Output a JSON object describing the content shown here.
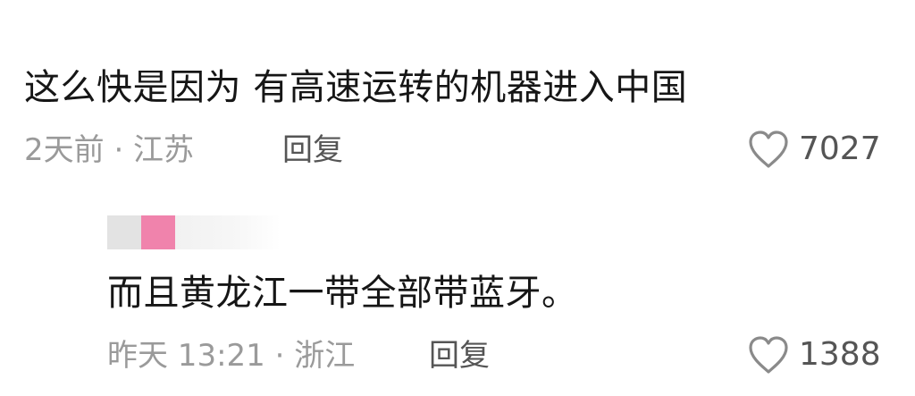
{
  "comments": [
    {
      "text": "这么快是因为 有高速运转的机器进入中国",
      "meta": "2天前 · 江苏",
      "reply_label": "回复",
      "likes": "7027"
    },
    {
      "text": "而且黄龙江一带全部带蓝牙。",
      "meta": "昨天 13:21 · 浙江",
      "reply_label": "回复",
      "likes": "1388"
    }
  ],
  "colors": {
    "avatar_gray": "#e3e3e3",
    "avatar_pink": "#f083ac",
    "meta_gray": "#9a9a9a",
    "heart_stroke": "#8a8a8a"
  },
  "icons": {
    "like": "heart-outline-icon"
  }
}
